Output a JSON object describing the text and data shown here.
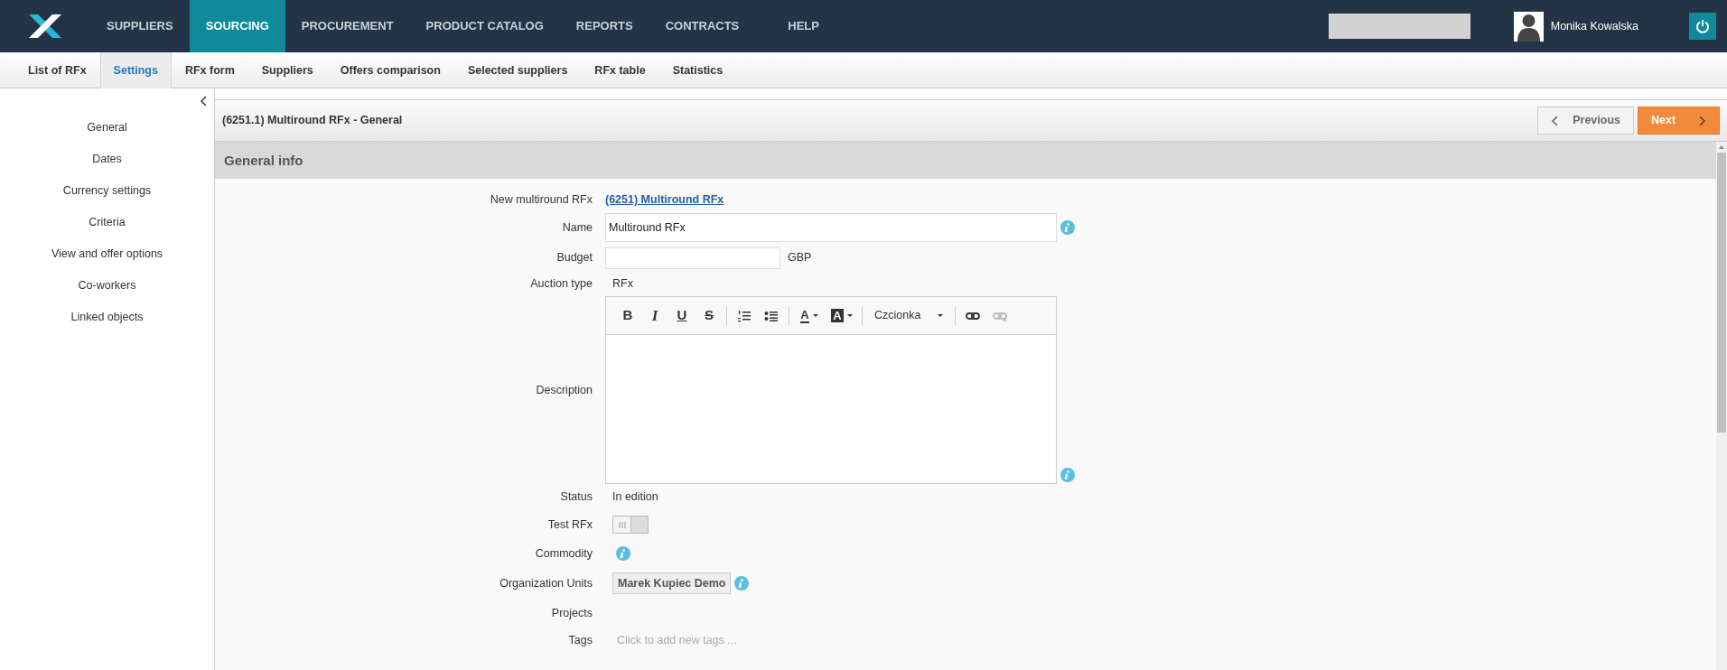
{
  "top_nav": {
    "items": [
      {
        "label": "SUPPLIERS",
        "selected": false
      },
      {
        "label": "SOURCING",
        "selected": true
      },
      {
        "label": "PROCUREMENT",
        "selected": false
      },
      {
        "label": "PRODUCT CATALOG",
        "selected": false
      },
      {
        "label": "REPORTS",
        "selected": false
      },
      {
        "label": "CONTRACTS",
        "selected": false
      },
      {
        "label": "HELP",
        "selected": false
      }
    ],
    "user": {
      "name": "Monika Kowalska"
    }
  },
  "sub_nav": {
    "items": [
      {
        "label": "List of RFx",
        "selected": false
      },
      {
        "label": "Settings",
        "selected": true
      },
      {
        "label": "RFx form",
        "selected": false
      },
      {
        "label": "Suppliers",
        "selected": false
      },
      {
        "label": "Offers comparison",
        "selected": false
      },
      {
        "label": "Selected suppliers",
        "selected": false
      },
      {
        "label": "RFx table",
        "selected": false
      },
      {
        "label": "Statistics",
        "selected": false
      }
    ]
  },
  "sidebar": {
    "items": [
      {
        "label": "General"
      },
      {
        "label": "Dates"
      },
      {
        "label": "Currency settings"
      },
      {
        "label": "Criteria"
      },
      {
        "label": "View and offer options"
      },
      {
        "label": "Co-workers"
      },
      {
        "label": "Linked objects"
      }
    ]
  },
  "panel": {
    "title": "(6251.1) Multiround RFx - General",
    "buttons": [
      {
        "label": "Previous",
        "kind": "previous"
      },
      {
        "label": "Next",
        "kind": "next"
      }
    ]
  },
  "section": {
    "title": "General info"
  },
  "form": {
    "fields": [
      {
        "label": "New multiround RFx",
        "kind": "link",
        "value": "(6251) Multiround RFx"
      },
      {
        "label": "Name",
        "kind": "input",
        "value": "Multiround RFx",
        "info": true
      },
      {
        "label": "Budget",
        "kind": "input_suffix",
        "suffix": "GBP"
      },
      {
        "label": "Auction type",
        "kind": "text",
        "value": "RFx"
      },
      {
        "label": "Description",
        "kind": "editor",
        "info": true,
        "toolbar": [
          {
            "kind": "bold",
            "glyph": "B"
          },
          {
            "kind": "italic",
            "glyph": "I"
          },
          {
            "kind": "underline",
            "glyph": "U"
          },
          {
            "kind": "strike",
            "glyph": "S"
          },
          {
            "kind": "separator"
          },
          {
            "kind": "ordered-list"
          },
          {
            "kind": "bullet-list"
          },
          {
            "kind": "separator"
          },
          {
            "kind": "text-color",
            "glyph": "A"
          },
          {
            "kind": "background-color",
            "glyph": "A"
          },
          {
            "kind": "separator"
          },
          {
            "kind": "font",
            "label": "Czcionka"
          },
          {
            "kind": "separator"
          },
          {
            "kind": "link",
            "disabled": false
          },
          {
            "kind": "unlink",
            "disabled": true
          }
        ]
      },
      {
        "label": "Status",
        "kind": "text",
        "value": "In edition"
      },
      {
        "label": "Test RFx",
        "kind": "toggle",
        "on": false
      },
      {
        "label": "Commodity",
        "kind": "empty",
        "info": true
      },
      {
        "label": "Organization Units",
        "kind": "tag",
        "value": "Marek Kupiec Demo",
        "info": true
      },
      {
        "label": "Projects",
        "kind": "empty"
      },
      {
        "label": "Tags",
        "kind": "tags",
        "placeholder": "Click to add new tags ..."
      }
    ]
  }
}
